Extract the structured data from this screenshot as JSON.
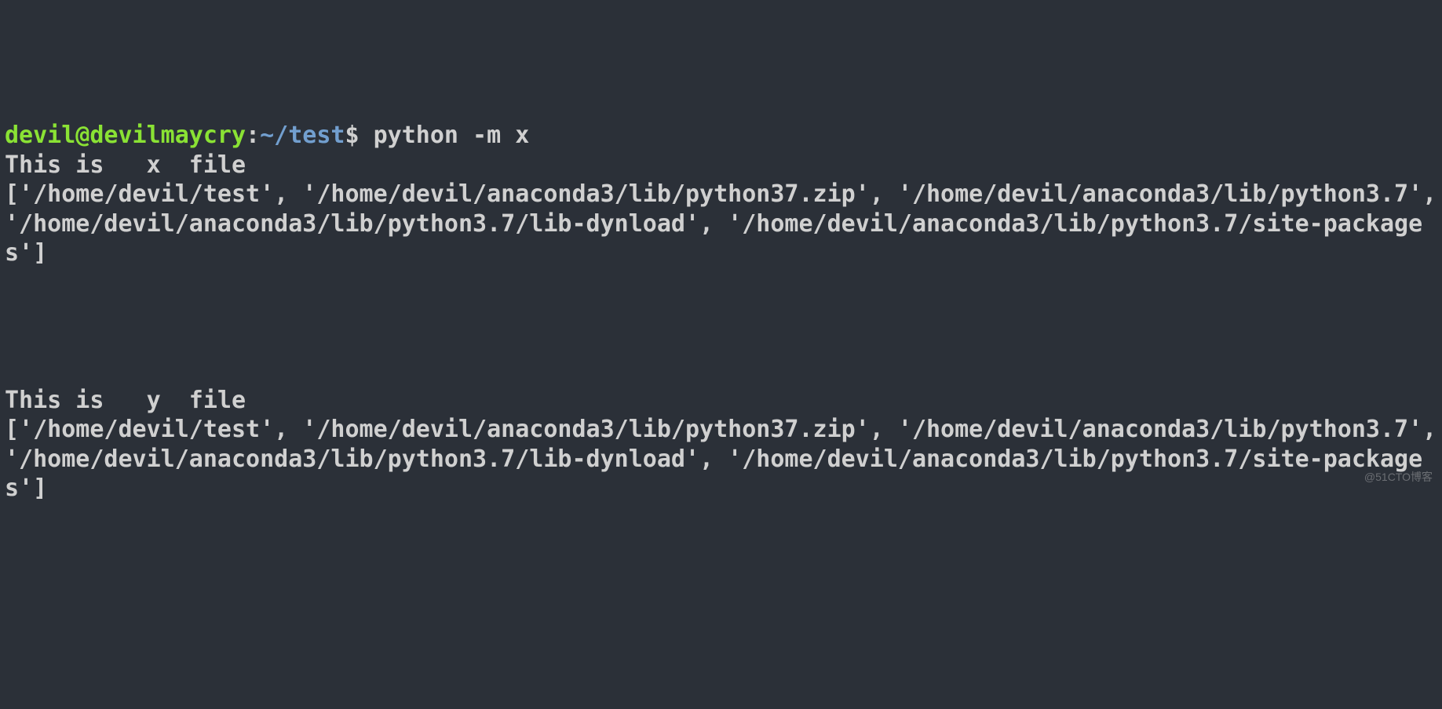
{
  "prompt": {
    "user_host": "devil@devilmaycry",
    "separator": ":",
    "path": "~/test",
    "dollar": "$"
  },
  "command": " python -m x",
  "output": {
    "line1": "This is   x  file",
    "line2": "['/home/devil/test', '/home/devil/anaconda3/lib/python37.zip', '/home/devil/anaconda3/lib/python3.7', '/home/devil/anaconda3/lib/python3.7/lib-dynload', '/home/devil/anaconda3/lib/python3.7/site-packages']",
    "blank1": "",
    "blank2": "",
    "blank3": "",
    "blank4": "",
    "line3": "This is   y  file",
    "line4": "['/home/devil/test', '/home/devil/anaconda3/lib/python37.zip', '/home/devil/anaconda3/lib/python3.7', '/home/devil/anaconda3/lib/python3.7/lib-dynload', '/home/devil/anaconda3/lib/python3.7/site-packages']"
  },
  "watermark": "@51CTO博客"
}
